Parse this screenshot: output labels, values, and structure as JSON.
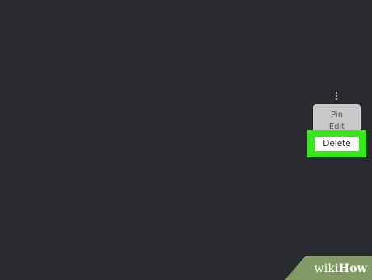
{
  "menu": {
    "trigger_icon": "vertical-ellipsis-icon",
    "items": [
      {
        "label": "Pin"
      },
      {
        "label": "Edit"
      },
      {
        "label": "Delete"
      }
    ]
  },
  "colors": {
    "background": "#2a2b30",
    "highlight": "#39e61d",
    "menu_bg": "#c9c9cc"
  },
  "watermark": {
    "brand_first": "wiki",
    "brand_second": "How"
  }
}
